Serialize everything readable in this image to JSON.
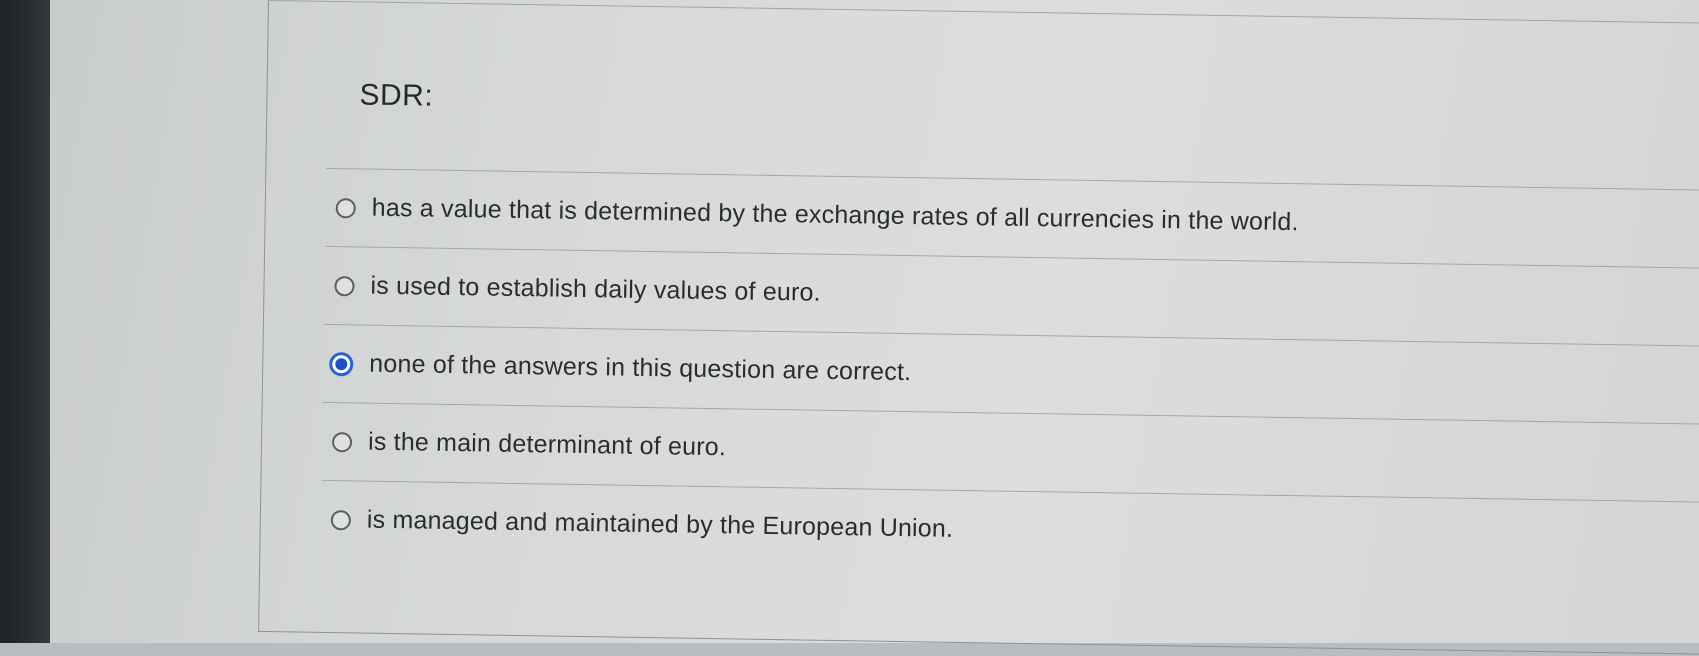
{
  "question": {
    "title": "SDR:",
    "options": [
      {
        "label": "has a value that is determined by the exchange rates of all currencies in the world.",
        "selected": false
      },
      {
        "label": "is used to establish daily values of euro.",
        "selected": false
      },
      {
        "label": "none of the answers in this question are correct.",
        "selected": true
      },
      {
        "label": "is the main determinant of euro.",
        "selected": false
      },
      {
        "label": "is managed and maintained by the European Union.",
        "selected": false
      }
    ]
  },
  "colors": {
    "selected_radio": "#1f4fc0",
    "text": "#2a2d30"
  }
}
